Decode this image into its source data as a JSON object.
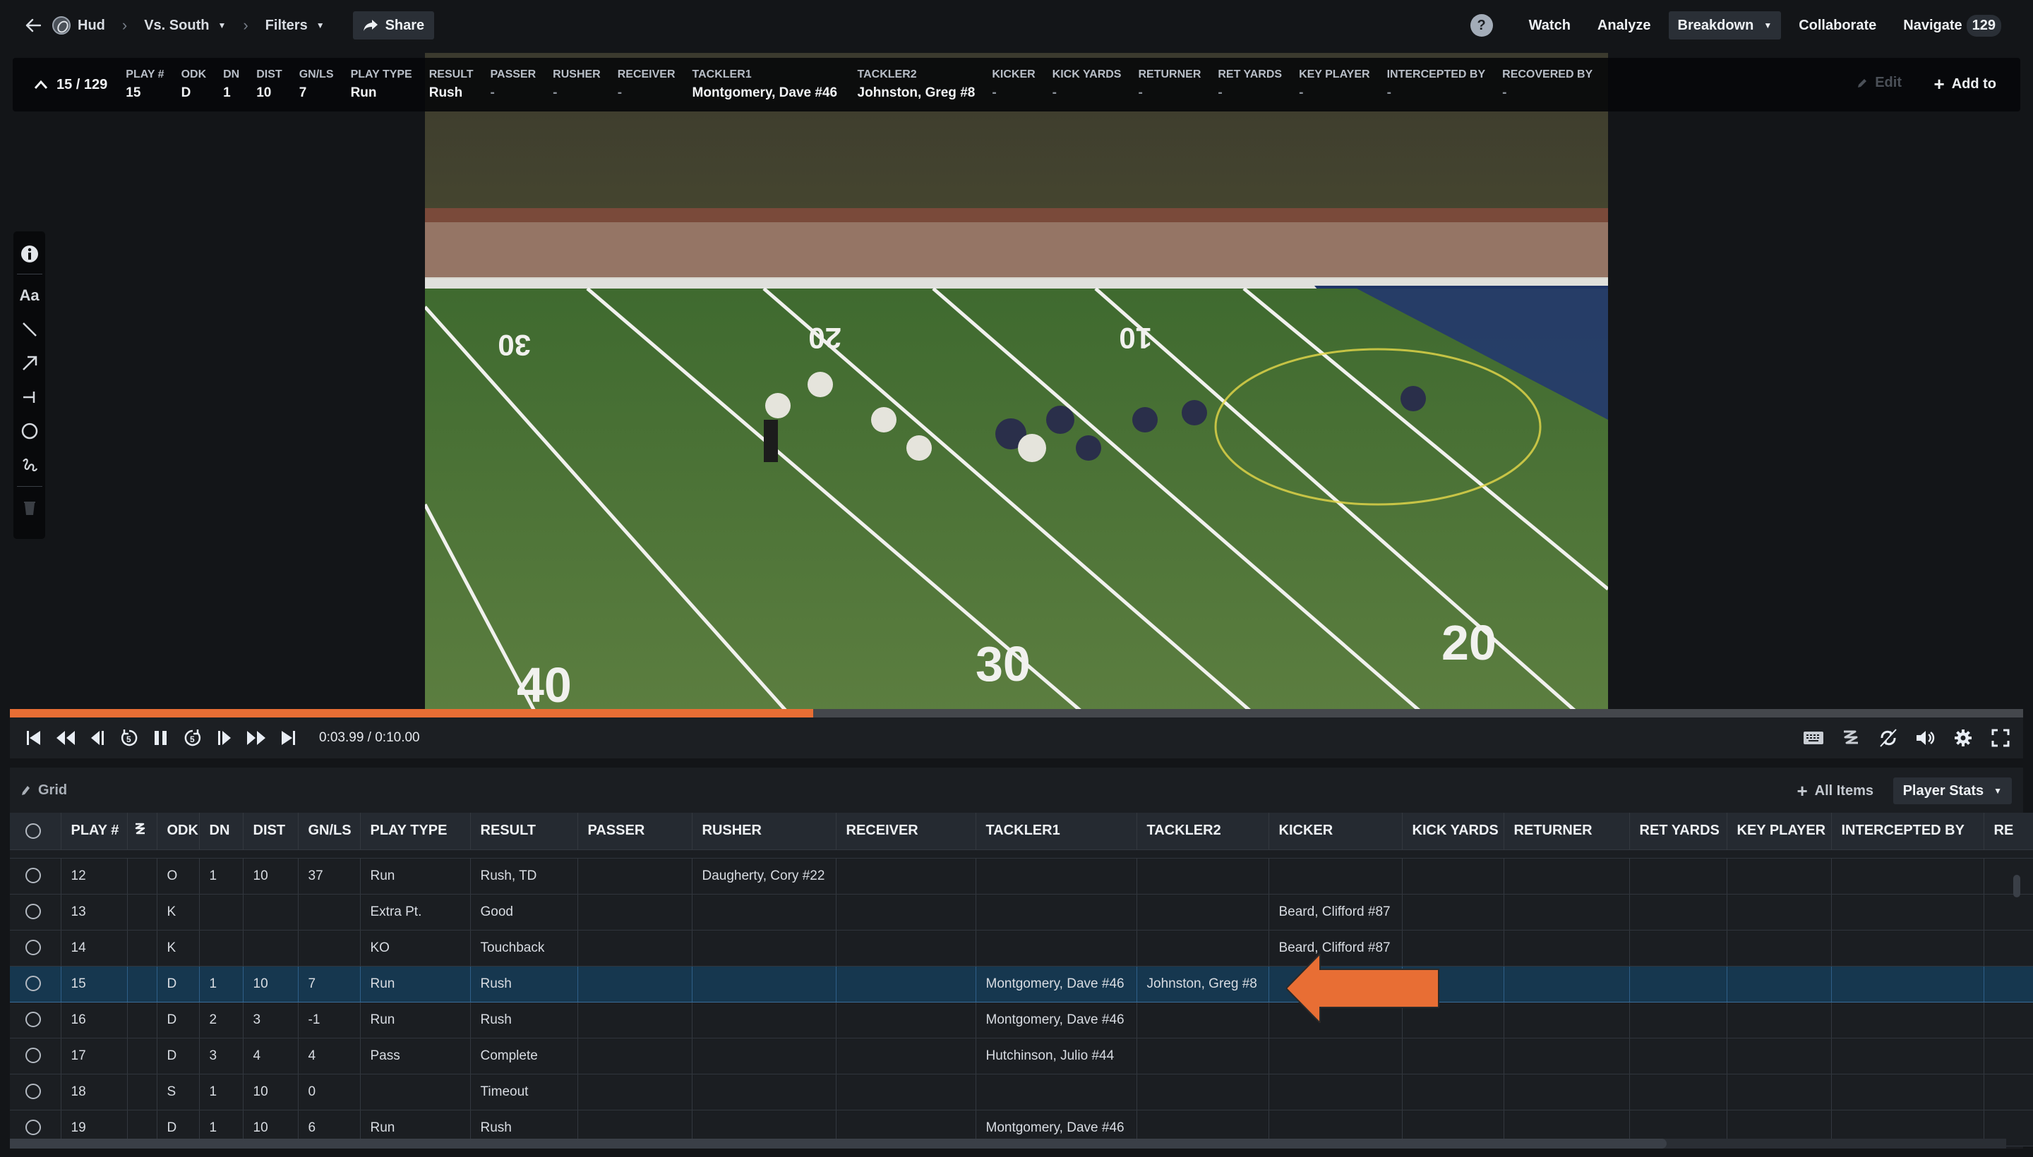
{
  "nav": {
    "back_icon": "arrow-left-icon",
    "team_logo_icon": "football-logo-icon",
    "breadcrumbs": [
      {
        "label": "Hud",
        "has_caret": false
      },
      {
        "label": "Vs. South",
        "has_caret": true
      },
      {
        "label": "Filters",
        "has_caret": true
      }
    ],
    "share_label": "Share",
    "help_label": "?",
    "items": [
      {
        "label": "Watch",
        "active": false
      },
      {
        "label": "Analyze",
        "active": false
      },
      {
        "label": "Breakdown",
        "active": true,
        "has_caret": true
      },
      {
        "label": "Collaborate",
        "active": false
      },
      {
        "label": "Navigate",
        "active": false
      }
    ],
    "navigate_count": "129"
  },
  "infobar": {
    "counter": "15 / 129",
    "fields": [
      {
        "label": "PLAY #",
        "value": "15"
      },
      {
        "label": "ODK",
        "value": "D"
      },
      {
        "label": "DN",
        "value": "1"
      },
      {
        "label": "DIST",
        "value": "10"
      },
      {
        "label": "GN/LS",
        "value": "7"
      },
      {
        "label": "PLAY TYPE",
        "value": "Run"
      },
      {
        "label": "RESULT",
        "value": "Rush"
      },
      {
        "label": "PASSER",
        "value": "-"
      },
      {
        "label": "RUSHER",
        "value": "-"
      },
      {
        "label": "RECEIVER",
        "value": "-"
      },
      {
        "label": "TACKLER1",
        "value": "Montgomery, Dave #46"
      },
      {
        "label": "TACKLER2",
        "value": "Johnston, Greg #8"
      },
      {
        "label": "KICKER",
        "value": "-"
      },
      {
        "label": "KICK YARDS",
        "value": "-"
      },
      {
        "label": "RETURNER",
        "value": "-"
      },
      {
        "label": "RET YARDS",
        "value": "-"
      },
      {
        "label": "KEY PLAYER",
        "value": "-"
      },
      {
        "label": "INTERCEPTED BY",
        "value": "-"
      },
      {
        "label": "RECOVERED BY",
        "value": "-"
      }
    ],
    "edit_label": "Edit",
    "add_to_label": "Add to"
  },
  "draw_tools": [
    {
      "name": "info-icon"
    },
    {
      "name": "text-tool-icon",
      "glyph": "Aa"
    },
    {
      "name": "line-tool-icon"
    },
    {
      "name": "arrow-tool-icon"
    },
    {
      "name": "t-bar-tool-icon"
    },
    {
      "name": "circle-tool-icon"
    },
    {
      "name": "freehand-tool-icon"
    },
    {
      "name": "trash-icon"
    }
  ],
  "player": {
    "progress": 0.399,
    "current_time": "0:03.99",
    "duration": "0:10.00",
    "time_display": "0:03.99 / 0:10.00"
  },
  "grid": {
    "title": "Grid",
    "all_items_label": "All Items",
    "view_select": "Player Stats",
    "columns": [
      "",
      "PLAY #",
      "",
      "ODK",
      "DN",
      "DIST",
      "GN/LS",
      "PLAY TYPE",
      "RESULT",
      "PASSER",
      "RUSHER",
      "RECEIVER",
      "TACKLER1",
      "TACKLER2",
      "KICKER",
      "KICK YARDS",
      "RETURNER",
      "RET YARDS",
      "KEY PLAYER",
      "INTERCEPTED BY",
      "RE"
    ],
    "selected_play": "15",
    "rows": [
      {
        "play": "12",
        "odk": "O",
        "dn": "1",
        "dist": "10",
        "gnls": "37",
        "play_type": "Run",
        "result": "Rush, TD",
        "passer": "",
        "rusher": "Daugherty, Cory #22",
        "receiver": "",
        "tackler1": "",
        "tackler2": "",
        "kicker": ""
      },
      {
        "play": "13",
        "odk": "K",
        "dn": "",
        "dist": "",
        "gnls": "",
        "play_type": "Extra Pt.",
        "result": "Good",
        "passer": "",
        "rusher": "",
        "receiver": "",
        "tackler1": "",
        "tackler2": "",
        "kicker": "Beard, Clifford #87"
      },
      {
        "play": "14",
        "odk": "K",
        "dn": "",
        "dist": "",
        "gnls": "",
        "play_type": "KO",
        "result": "Touchback",
        "passer": "",
        "rusher": "",
        "receiver": "",
        "tackler1": "",
        "tackler2": "",
        "kicker": "Beard, Clifford #87"
      },
      {
        "play": "15",
        "odk": "D",
        "dn": "1",
        "dist": "10",
        "gnls": "7",
        "play_type": "Run",
        "result": "Rush",
        "passer": "",
        "rusher": "",
        "receiver": "",
        "tackler1": "Montgomery, Dave #46",
        "tackler2": "Johnston, Greg #8",
        "kicker": ""
      },
      {
        "play": "16",
        "odk": "D",
        "dn": "2",
        "dist": "3",
        "gnls": "-1",
        "play_type": "Run",
        "result": "Rush",
        "passer": "",
        "rusher": "",
        "receiver": "",
        "tackler1": "Montgomery, Dave #46",
        "tackler2": "",
        "kicker": ""
      },
      {
        "play": "17",
        "odk": "D",
        "dn": "3",
        "dist": "4",
        "gnls": "4",
        "play_type": "Pass",
        "result": "Complete",
        "passer": "",
        "rusher": "",
        "receiver": "",
        "tackler1": "Hutchinson, Julio #44",
        "tackler2": "",
        "kicker": ""
      },
      {
        "play": "18",
        "odk": "S",
        "dn": "1",
        "dist": "10",
        "gnls": "0",
        "play_type": "",
        "result": "Timeout",
        "passer": "",
        "rusher": "",
        "receiver": "",
        "tackler1": "",
        "tackler2": "",
        "kicker": ""
      },
      {
        "play": "19",
        "odk": "D",
        "dn": "1",
        "dist": "10",
        "gnls": "6",
        "play_type": "Run",
        "result": "Rush",
        "passer": "",
        "rusher": "",
        "receiver": "",
        "tackler1": "Montgomery, Dave #46",
        "tackler2": "",
        "kicker": ""
      }
    ]
  },
  "annotation": {
    "type": "arrow-left",
    "color": "#e86e34",
    "points_to": "TACKLER2 Johnston, Greg #8"
  },
  "colors": {
    "accent": "#e86e34",
    "selected_row": "#16374f",
    "background": "#131518"
  }
}
